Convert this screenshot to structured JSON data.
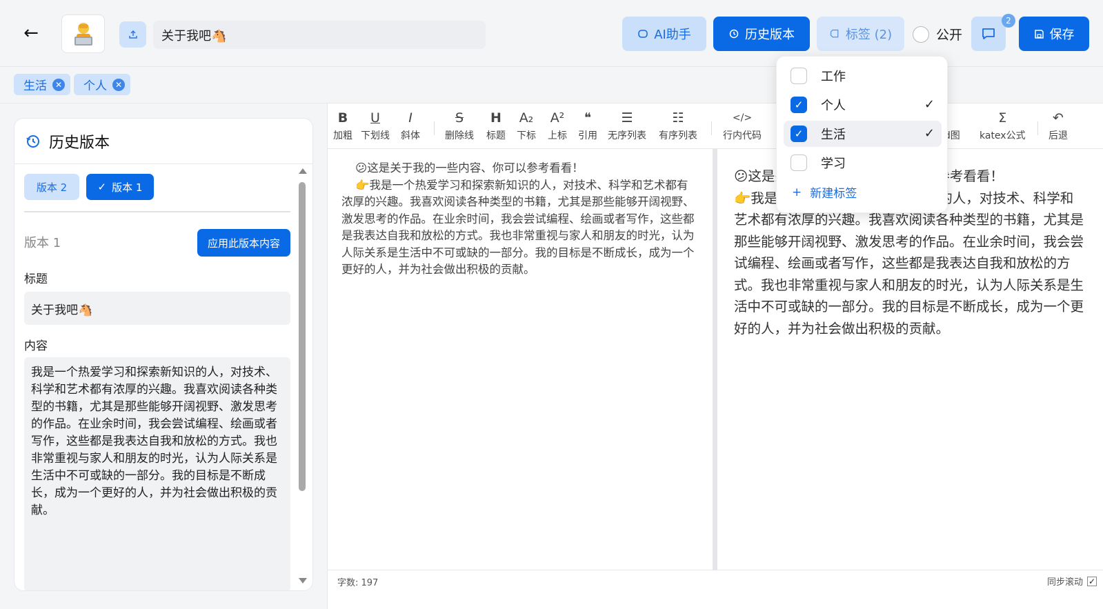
{
  "header": {
    "title_value": "关于我吧🐴",
    "ai_label": "AI助手",
    "history_label": "历史版本",
    "tags_label": "标签 (2)",
    "public_label": "公开",
    "comment_badge": "2",
    "save_label": "保存",
    "avatar_emoji": "🧑‍💻"
  },
  "tags": [
    {
      "label": "生活"
    },
    {
      "label": "个人"
    }
  ],
  "history": {
    "title": "历史版本",
    "tabs": [
      {
        "label": "版本 2"
      },
      {
        "label": "版本 1",
        "mark": "✓"
      }
    ],
    "selected_name": "版本 1",
    "apply_label": "应用此版本内容",
    "title_label": "标题",
    "title_value": "关于我吧🐴",
    "content_label": "内容",
    "content_value": "我是一个热爱学习和探索新知识的人，对技术、科学和艺术都有浓厚的兴趣。我喜欢阅读各种类型的书籍，尤其是那些能够开阔视野、激发思考的作品。在业余时间，我会尝试编程、绘画或者写作，这些都是我表达自我和放松的方式。我也非常重视与家人和朋友的时光，认为人际关系是生活中不可或缺的一部分。我的目标是不断成长，成为一个更好的人，并为社会做出积极的贡献。"
  },
  "toolbar": [
    {
      "icon": "B",
      "label": "加粗"
    },
    {
      "icon": "U",
      "label": "下划线"
    },
    {
      "icon": "I",
      "label": "斜体"
    },
    {
      "icon": "S",
      "label": "删除线"
    },
    {
      "icon": "H",
      "label": "标题"
    },
    {
      "icon": "A₂",
      "label": "下标"
    },
    {
      "icon": "A²",
      "label": "上标"
    },
    {
      "icon": "❝",
      "label": "引用"
    },
    {
      "icon": "☰",
      "label": "无序列表"
    },
    {
      "icon": "☷",
      "label": "有序列表"
    },
    {
      "icon": "</>",
      "label": "行内代码"
    },
    {
      "icon": "⇆",
      "label": "mermaid图"
    },
    {
      "icon": "Σ",
      "label": "katex公式"
    },
    {
      "icon": "↶",
      "label": "后退"
    }
  ],
  "editor": {
    "line1": "😕这是关于我的一些内容、你可以参考看看！",
    "line2": "👉我是一个热爱学习和探索新知识的人，对技术、科学和艺术都有浓厚的兴趣。我喜欢阅读各种类型的书籍，尤其是那些能够开阔视野、激发思考的作品。在业余时间，我会尝试编程、绘画或者写作，这些都是我表达自我和放松的方式。我也非常重视与家人和朋友的时光，认为人际关系是生活中不可或缺的一部分。我的目标是不断成长，成为一个更好的人，并为社会做出积极的贡献。",
    "preview_line1": "😕这是关于我的一些内容、你可以参考看看！",
    "preview_line2": "👉我是一个热爱学习和探索新知识的人，对技术、科学和艺术都有浓厚的兴趣。我喜欢阅读各种类型的书籍，尤其是那些能够开阔视野、激发思考的作品。在业余时间，我会尝试编程、绘画或者写作，这些都是我表达自我和放松的方式。我也非常重视与家人和朋友的时光，认为人际关系是生活中不可或缺的一部分。我的目标是不断成长，成为一个更好的人，并为社会做出积极的贡献。",
    "word_count": "字数: 197",
    "sync_label": "同步滚动",
    "sync_mark": "✓"
  },
  "dropdown": {
    "items": [
      {
        "label": "工作",
        "checked": false
      },
      {
        "label": "个人",
        "checked": true
      },
      {
        "label": "生活",
        "checked": true
      },
      {
        "label": "学习",
        "checked": false
      }
    ],
    "check_mark": "✓",
    "new_label": "新建标签",
    "new_mark": "+"
  },
  "colors": {
    "primary": "#0a6ae6",
    "primary_light": "#cfe2fb"
  }
}
